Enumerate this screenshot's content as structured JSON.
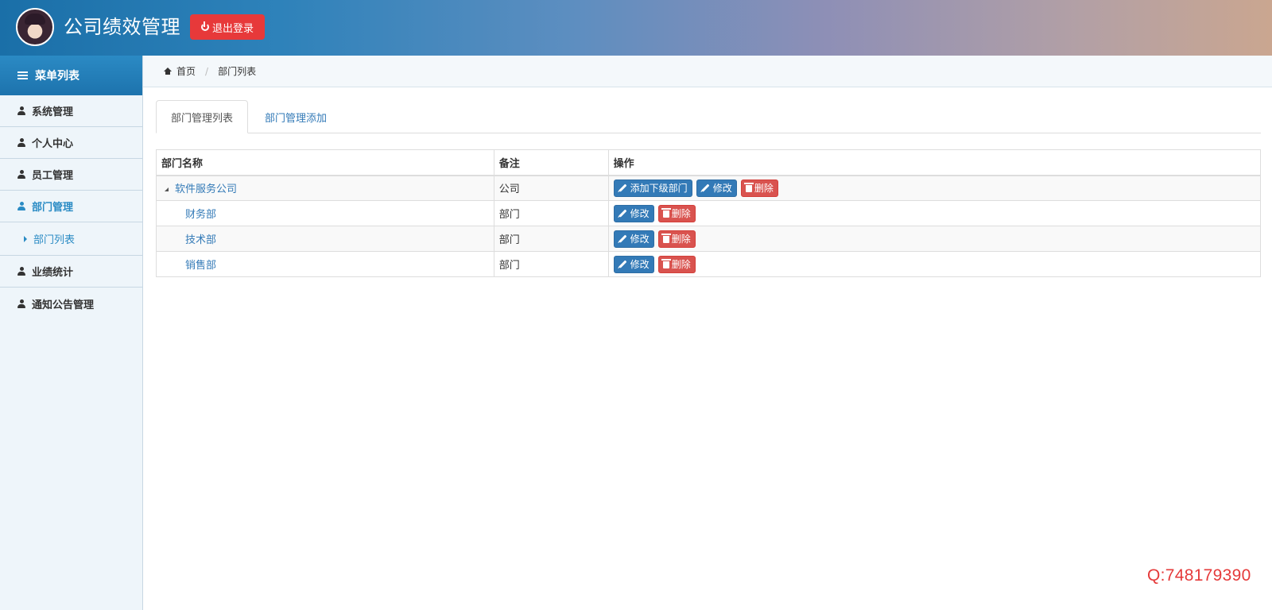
{
  "header": {
    "title": "公司绩效管理",
    "logout_label": "退出登录"
  },
  "sidebar": {
    "heading": "菜单列表",
    "items": [
      {
        "label": "系统管理"
      },
      {
        "label": "个人中心"
      },
      {
        "label": "员工管理"
      },
      {
        "label": "部门管理",
        "active": true,
        "sub": [
          {
            "label": "部门列表"
          }
        ]
      },
      {
        "label": "业绩统计"
      },
      {
        "label": "通知公告管理"
      }
    ]
  },
  "breadcrumb": {
    "home": "首页",
    "current": "部门列表"
  },
  "tabs": [
    {
      "label": "部门管理列表",
      "active": true
    },
    {
      "label": "部门管理添加"
    }
  ],
  "table": {
    "headers": [
      "部门名称",
      "备注",
      "操作"
    ],
    "rows": [
      {
        "name": "软件服务公司",
        "note": "公司",
        "actions": [
          "添加下级部门",
          "修改",
          "删除"
        ]
      },
      {
        "name": "财务部",
        "note": "部门",
        "actions": [
          "修改",
          "删除"
        ]
      },
      {
        "name": "技术部",
        "note": "部门",
        "actions": [
          "修改",
          "删除"
        ]
      },
      {
        "name": "销售部",
        "note": "部门",
        "actions": [
          "修改",
          "删除"
        ]
      }
    ]
  },
  "watermark": "Q:748179390",
  "colors": {
    "header_start": "#1a6fa8",
    "accent": "#2a8bc4",
    "logout": "#e7393a",
    "primary_btn": "#337ab7",
    "danger_btn": "#d9534f"
  }
}
